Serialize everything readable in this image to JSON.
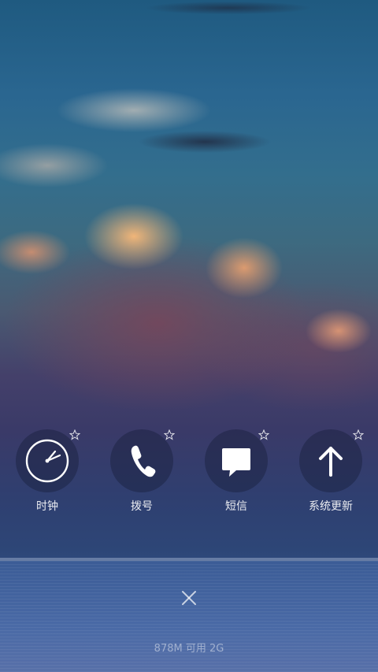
{
  "recent_apps": [
    {
      "label": "时钟",
      "icon": "clock-icon",
      "locked": false
    },
    {
      "label": "拨号",
      "icon": "phone-icon",
      "locked": false
    },
    {
      "label": "短信",
      "icon": "message-icon",
      "locked": false
    },
    {
      "label": "系统更新",
      "icon": "arrow-up-icon",
      "locked": false
    }
  ],
  "memory_status": "878M 可用 2G",
  "colors": {
    "icon_glyph": "#ffffff",
    "icon_bg": "#191e3c",
    "label_text": "#ffffff"
  }
}
